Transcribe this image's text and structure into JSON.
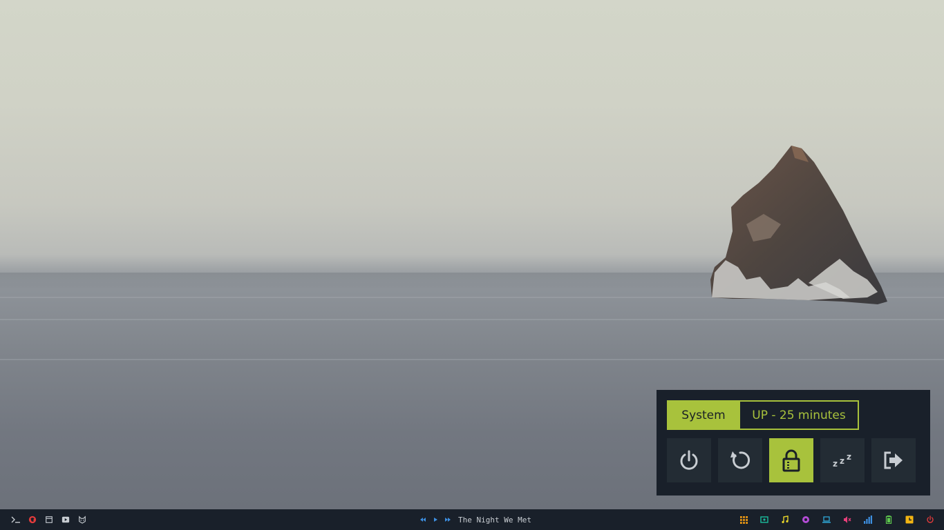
{
  "power_menu": {
    "title": "System",
    "uptime": "UP - 25 minutes",
    "buttons": [
      {
        "name": "shutdown",
        "icon": "power-icon"
      },
      {
        "name": "reboot",
        "icon": "reboot-icon"
      },
      {
        "name": "lock",
        "icon": "lock-icon",
        "selected": true
      },
      {
        "name": "suspend",
        "icon": "sleep-icon"
      },
      {
        "name": "logout",
        "icon": "logout-icon"
      }
    ],
    "colors": {
      "accent": "#a8c23c",
      "panel": "#19202a",
      "button": "#232c34",
      "icon": "#c8cdd2"
    }
  },
  "taskbar": {
    "launchers": [
      {
        "icon": "terminal-icon",
        "color": "#c8cdd2"
      },
      {
        "icon": "browser-icon",
        "color": "#e23b3b"
      },
      {
        "icon": "files-icon",
        "color": "#c8cdd2"
      },
      {
        "icon": "youtube-icon",
        "color": "#c8cdd2"
      },
      {
        "icon": "cat-icon",
        "color": "#c8cdd2"
      }
    ],
    "media": {
      "track": "The Night We Met",
      "controls": [
        "previous-icon",
        "play-icon",
        "next-icon"
      ],
      "color": "#3d8fe0"
    },
    "tray": [
      {
        "icon": "apps-grid-icon",
        "color": "#f39c12"
      },
      {
        "icon": "display-icon",
        "color": "#1abc9c"
      },
      {
        "icon": "music-note-icon",
        "color": "#e5d32a"
      },
      {
        "icon": "cpu-icon",
        "color": "#b44cd6"
      },
      {
        "icon": "laptop-icon",
        "color": "#2fa8d8"
      },
      {
        "icon": "volume-muted-icon",
        "color": "#e83f7a"
      },
      {
        "icon": "signal-icon",
        "color": "#3d8fe0"
      },
      {
        "icon": "battery-icon",
        "color": "#5ec94e"
      },
      {
        "icon": "clock-icon",
        "color": "#f3b512"
      },
      {
        "icon": "power-icon",
        "color": "#e23b3b"
      }
    ]
  }
}
